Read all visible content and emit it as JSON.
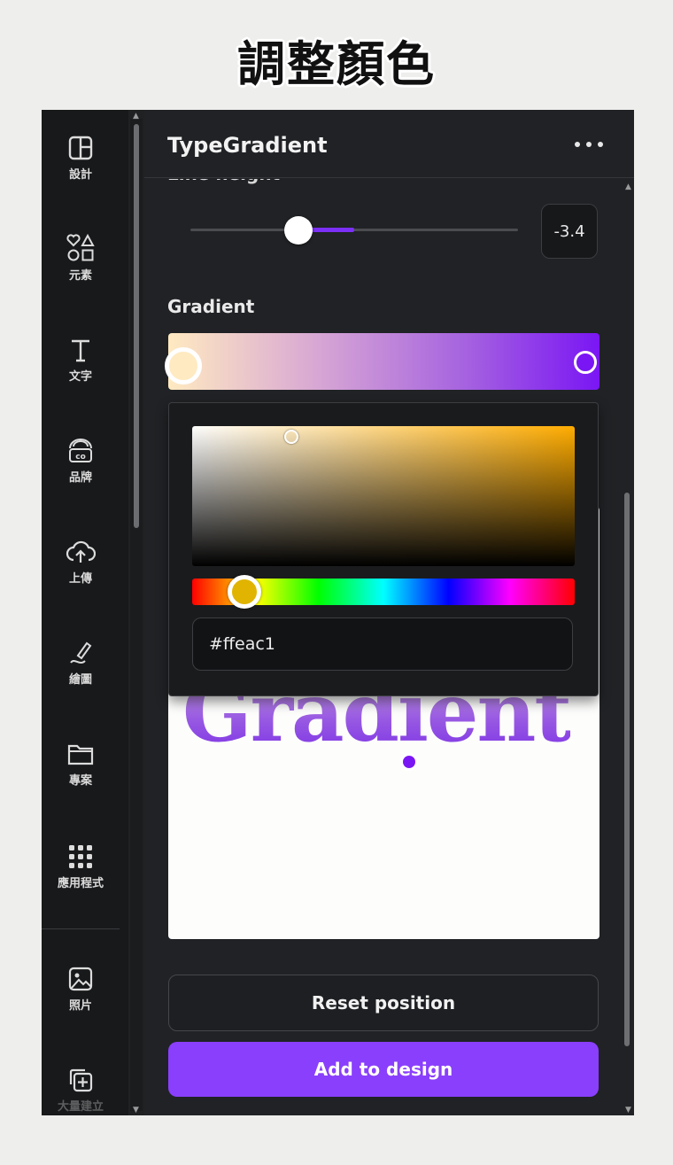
{
  "caption": "調整顏色",
  "rail": {
    "items": [
      {
        "label": "設計",
        "icon": "layout-icon"
      },
      {
        "label": "元素",
        "icon": "shapes-icon"
      },
      {
        "label": "文字",
        "icon": "text-icon"
      },
      {
        "label": "品牌",
        "icon": "brand-icon"
      },
      {
        "label": "上傳",
        "icon": "cloud-upload-icon"
      },
      {
        "label": "繪圖",
        "icon": "draw-icon"
      },
      {
        "label": "專案",
        "icon": "folder-icon"
      },
      {
        "label": "應用程式",
        "icon": "apps-grid-icon"
      },
      {
        "label": "照片",
        "icon": "photo-icon"
      },
      {
        "label": "大量建立",
        "icon": "bulk-create-icon"
      }
    ]
  },
  "panel": {
    "title": "TypeGradient",
    "more_icon": "more-dots-icon",
    "cut_label": "Line height",
    "line_height": {
      "value": "-3.4"
    },
    "gradient_label": "Gradient",
    "gradient": {
      "start_color": "#ffeac1",
      "end_color": "#7a16f4"
    },
    "picker": {
      "hex_value": "#ffeac1",
      "hue_color": "#ffac00"
    },
    "preview_text": "Gradient",
    "reset_label": "Reset position",
    "add_label": "Add to design",
    "accent": "#8a3ffc"
  }
}
